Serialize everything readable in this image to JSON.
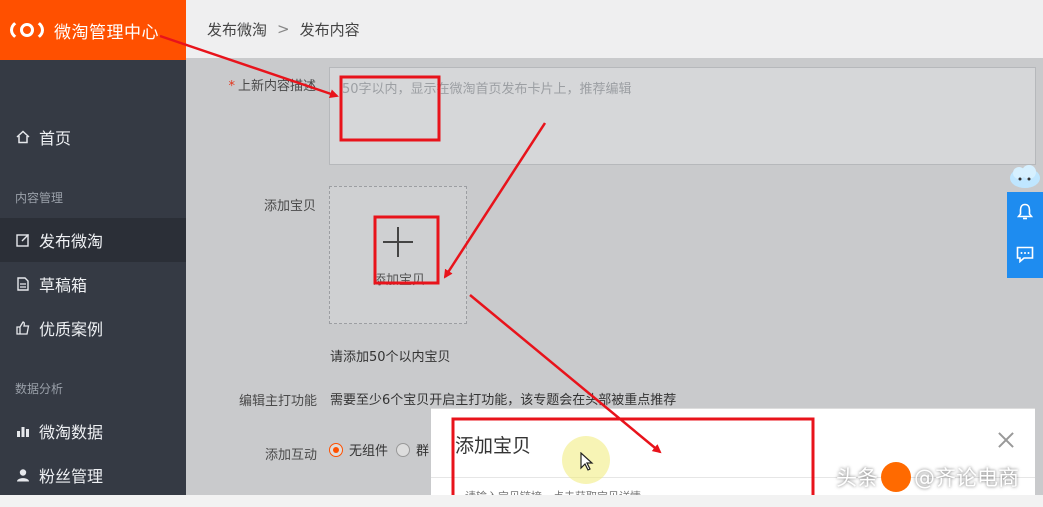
{
  "brand": {
    "title": "微淘管理中心"
  },
  "breadcrumb": {
    "parent": "发布微淘",
    "separator": ">",
    "current": "发布内容"
  },
  "sidebar": {
    "home": "首页",
    "section_content": "内容管理",
    "publish": "发布微淘",
    "drafts": "草稿箱",
    "cases": "优质案例",
    "section_data": "数据分析",
    "stats": "微淘数据",
    "fans": "粉丝管理"
  },
  "form": {
    "desc_label": "上新内容描述",
    "desc_placeholder": "50字以内，显示在微淘首页发布卡片上，推荐编辑",
    "add_label": "添加宝贝",
    "add_button": "添加宝贝",
    "add_hint": "请添加50个以内宝贝",
    "focus_label": "编辑主打功能",
    "focus_text": "需要至少6个宝贝开启主打功能，该专题会在头部被重点推荐",
    "interact_label": "添加互动",
    "interact_option_none": "无组件",
    "interact_option_group": "群"
  },
  "modal": {
    "title": "添加宝贝",
    "input_placeholder": "请输入宝贝链接，点击获取宝贝详情"
  },
  "watermark": {
    "prefix": "头条",
    "handle": "@齐论电商"
  },
  "colors": {
    "brand": "#ff5000",
    "annotation": "#e8131b",
    "tool": "#1e8cf0",
    "sidebar": "#353a44"
  }
}
